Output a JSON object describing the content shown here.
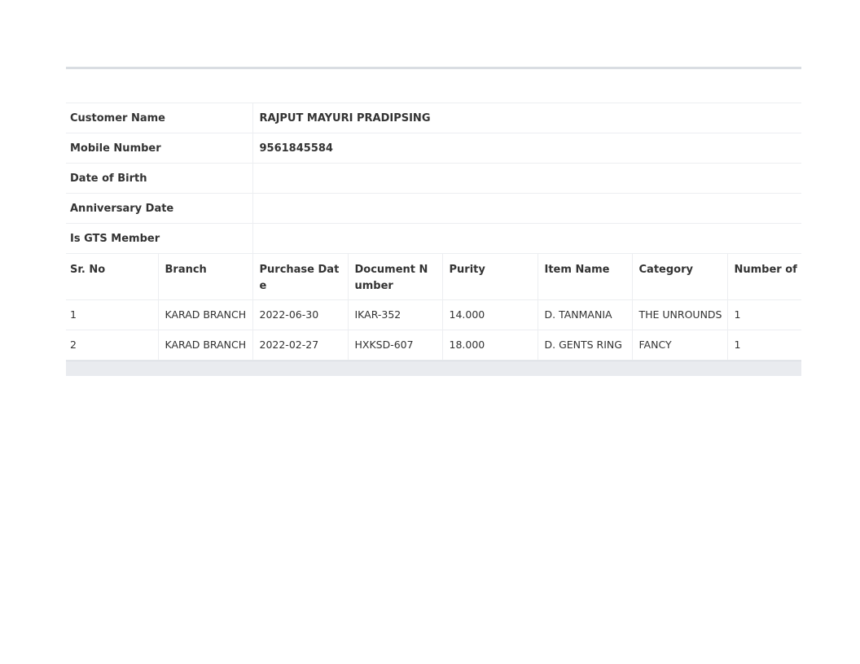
{
  "customer_info": {
    "rows": [
      {
        "label": "Customer Name",
        "value": "RAJPUT MAYURI PRADIPSING"
      },
      {
        "label": "Mobile Number",
        "value": "9561845584"
      },
      {
        "label": "Date of Birth",
        "value": ""
      },
      {
        "label": "Anniversary Date",
        "value": ""
      },
      {
        "label": "Is GTS Member",
        "value": ""
      }
    ]
  },
  "purchases": {
    "headers": [
      "Sr. No",
      "Branch",
      "Purchase Date",
      "Document Number",
      "Purity",
      "Item Name",
      "Category",
      "Number of PCS"
    ],
    "rows": [
      [
        "1",
        "KARAD BRANCH",
        "2022-06-30",
        "IKAR-352",
        "14.000",
        "D. TANMANIA",
        "THE UNROUNDS",
        "1"
      ],
      [
        "2",
        "KARAD BRANCH",
        "2022-02-27",
        "HXKSD-607",
        "18.000",
        "D. GENTS RING",
        "FANCY",
        "1"
      ]
    ]
  }
}
